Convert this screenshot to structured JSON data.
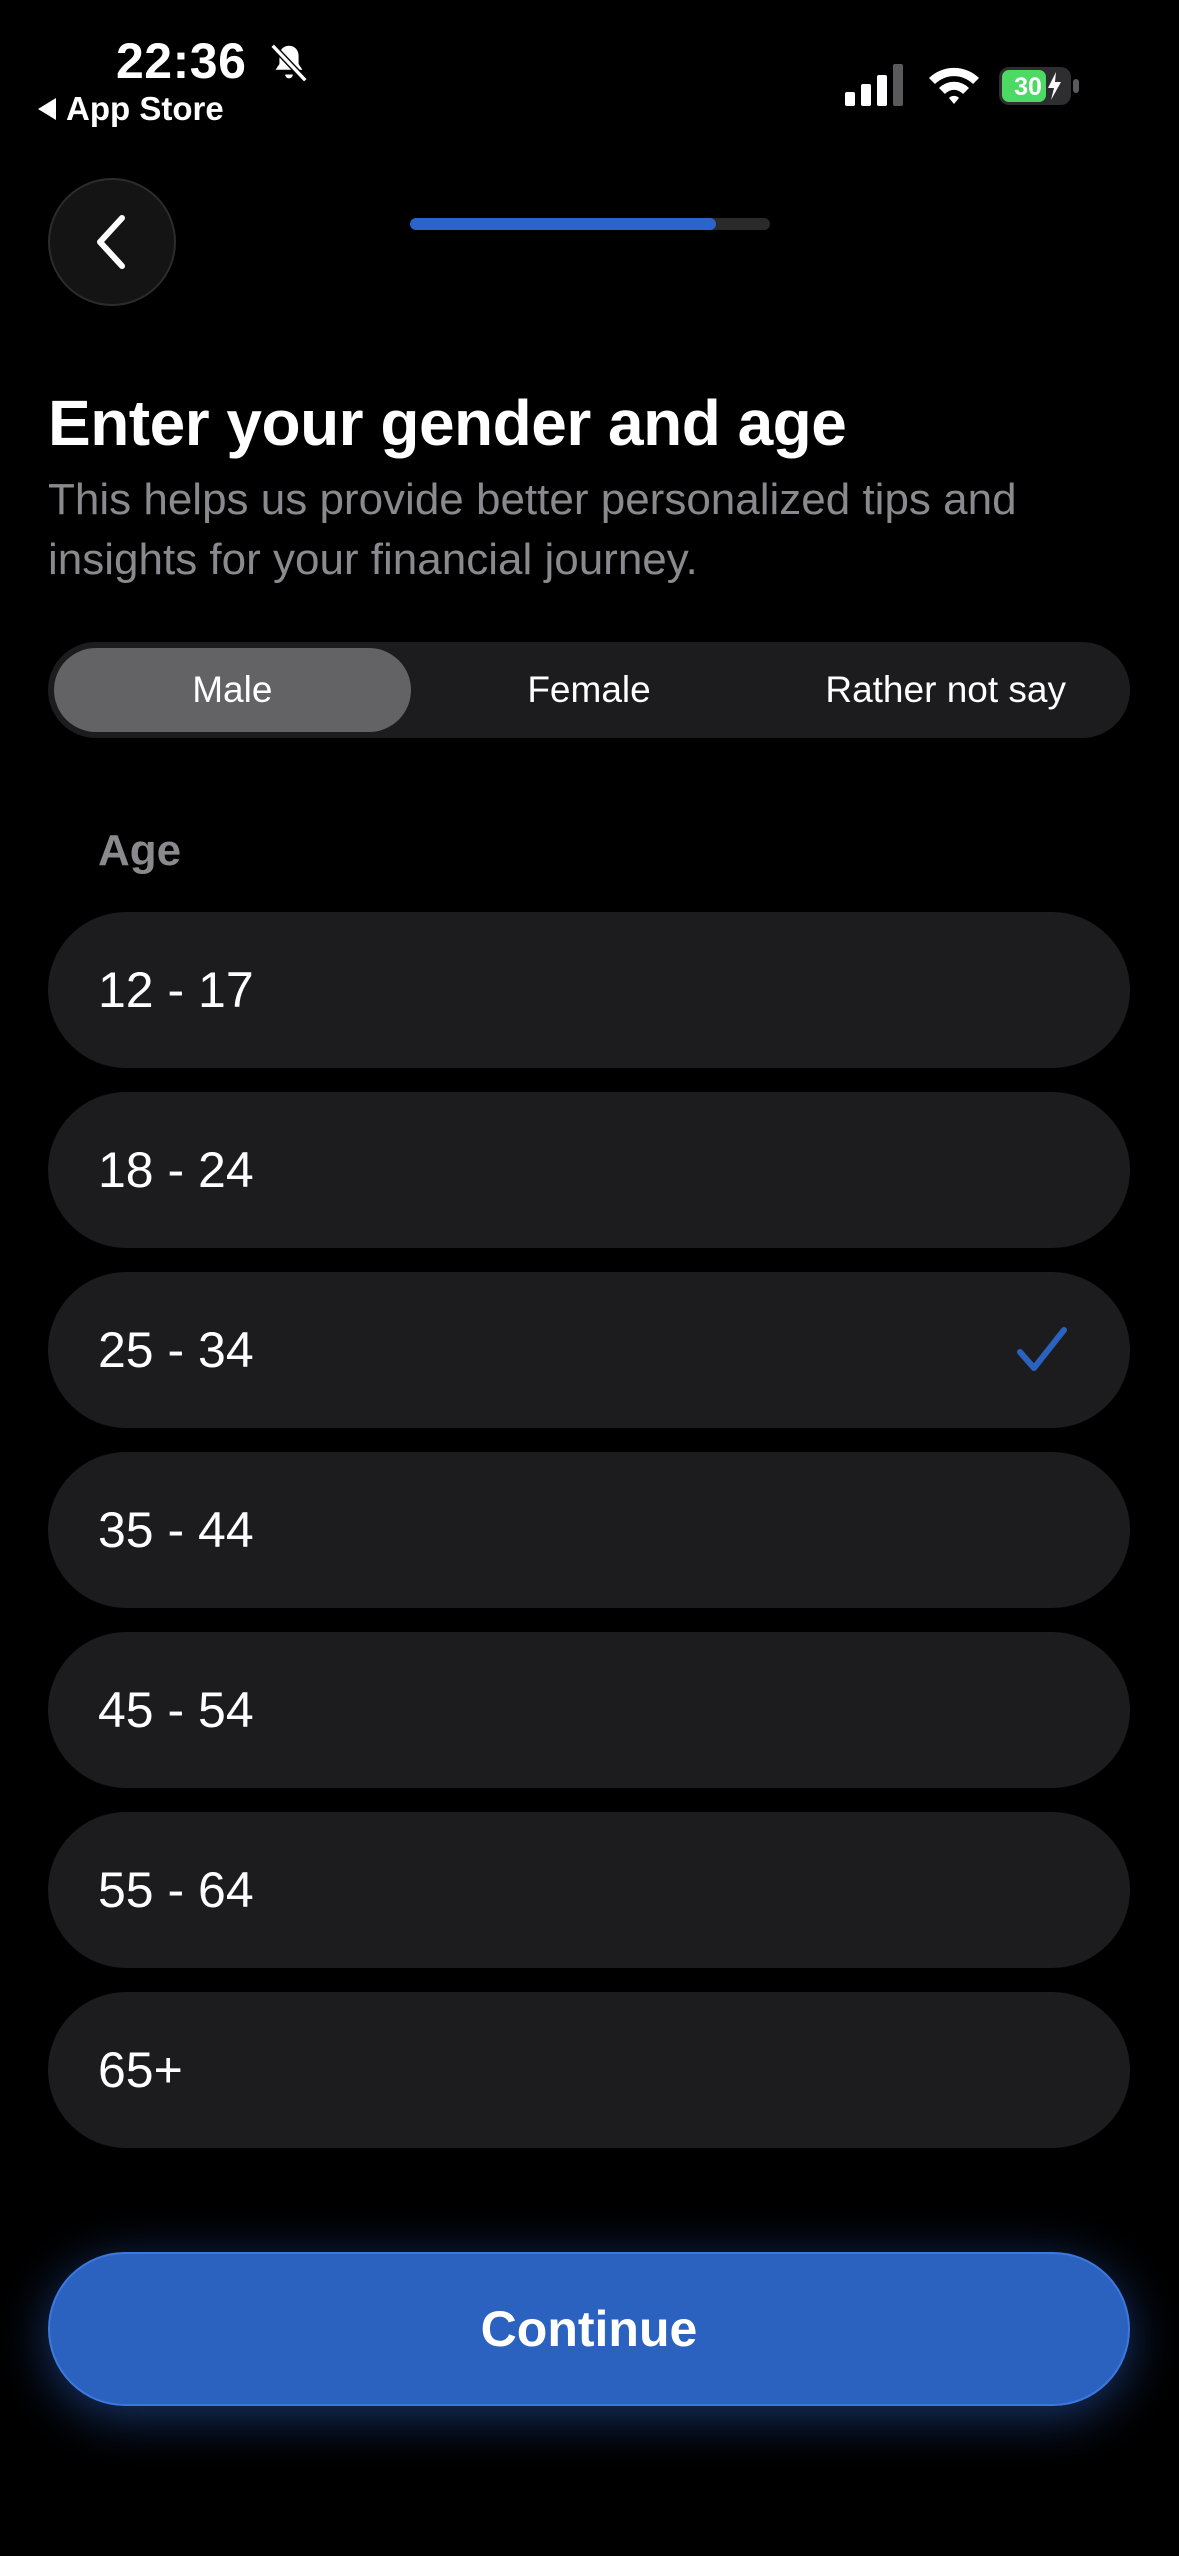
{
  "status_bar": {
    "time": "22:36",
    "back_app": "App Store",
    "battery": "30"
  },
  "header": {
    "progress": 0.85
  },
  "title": "Enter your gender and age",
  "subtitle": "This helps us provide better personalized tips and insights for your financial journey.",
  "gender": {
    "options": [
      "Male",
      "Female",
      "Rather not say"
    ],
    "selected": "Male"
  },
  "age": {
    "label": "Age",
    "options": [
      "12 - 17",
      "18 - 24",
      "25 - 34",
      "35 - 44",
      "45 - 54",
      "55 - 64",
      "65+"
    ],
    "selected": "25 - 34"
  },
  "continue_label": "Continue",
  "colors": {
    "accent": "#2b62c0",
    "battery": "#4cd964"
  }
}
